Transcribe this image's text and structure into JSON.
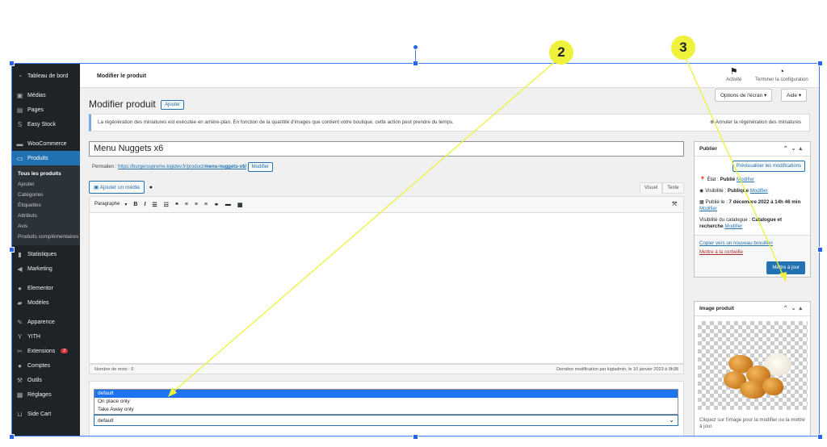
{
  "sidebar": {
    "items": [
      {
        "label": "Tableau de bord",
        "icon": "dashboard-icon"
      },
      {
        "label": "Médias",
        "icon": "media-icon"
      },
      {
        "label": "Pages",
        "icon": "pages-icon"
      },
      {
        "label": "Easy Stock",
        "icon": "stock-icon"
      },
      {
        "label": "WooCommerce",
        "icon": "woocommerce-icon"
      },
      {
        "label": "Produits",
        "icon": "products-icon"
      }
    ],
    "submenu": [
      "Tous les produits",
      "Ajouter",
      "Catégories",
      "Étiquettes",
      "Attributs",
      "Avis",
      "Produits complémentaires"
    ],
    "items2": [
      {
        "label": "Statistiques",
        "icon": "chart-icon"
      },
      {
        "label": "Marketing",
        "icon": "megaphone-icon"
      },
      {
        "label": "Elementor",
        "icon": "elementor-icon"
      },
      {
        "label": "Modèles",
        "icon": "folder-icon"
      },
      {
        "label": "Apparence",
        "icon": "brush-icon"
      },
      {
        "label": "YITH",
        "icon": "yith-icon"
      },
      {
        "label": "Extensions",
        "icon": "plugin-icon",
        "badge": "2"
      },
      {
        "label": "Comptes",
        "icon": "user-icon"
      },
      {
        "label": "Outils",
        "icon": "wrench-icon"
      },
      {
        "label": "Réglages",
        "icon": "settings-icon"
      },
      {
        "label": "Side Cart",
        "icon": "cart-icon"
      }
    ]
  },
  "topbar": {
    "title": "Modifier le produit",
    "activity": "Activité",
    "finish_setup": "Terminer la configuration"
  },
  "screen_options": "Options de l'écran ▾",
  "help": "Aide ▾",
  "page": {
    "heading": "Modifier produit",
    "add_button": "Ajouter"
  },
  "notice": {
    "text": "La régénération des miniatures est exécutée en arrière-plan. En fonction de la quantité d'images que contient votre boutique, cette action peut prendre du temps.",
    "cancel": "Annuler la régénération des miniatures"
  },
  "product": {
    "title": "Menu Nuggets x6",
    "permalink_label": "Permalien :",
    "permalink_base": "https://burgersupreme.kigidev.fr/product/",
    "permalink_slug": "menu-nuggets-x6/",
    "permalink_edit": "Modifier"
  },
  "editor": {
    "add_media": "Ajouter un média",
    "tab_visual": "Visuel",
    "tab_text": "Texte",
    "format": "Paragraphe",
    "word_count": "Nombre de mots : 0",
    "last_modified": "Dernière modification par kigiadmin, le 10 janvier 2023 à 9h38"
  },
  "dropdown": {
    "options": [
      "default",
      "On place only",
      "Take Away only"
    ],
    "selected": "default"
  },
  "publish": {
    "title": "Publier",
    "preview": "Prévisualiser les modifications",
    "status_label": "État :",
    "status_value": "Publié",
    "visibility_label": "Visibilité :",
    "visibility_value": "Publique",
    "published_label": "Publié le :",
    "published_value": "7 décembre 2022 à 14h 46 min",
    "catalog_label": "Visibilité du catalogue :",
    "catalog_value": "Catalogue et recherche",
    "edit": "Modifier",
    "copy_draft": "Copier vers un nouveau brouillon",
    "trash": "Mettre à la corbeille",
    "update": "Mettre à jour"
  },
  "product_image": {
    "title": "Image produit",
    "hint": "Cliquez sur l'image pour la modifier ou la mettre à jour."
  },
  "annotations": [
    {
      "number": "2"
    },
    {
      "number": "3"
    }
  ],
  "colors": {
    "sidebar_bg": "#1d2327",
    "accent": "#2271b1",
    "annotation": "#eef23a",
    "selection": "#1e74f0"
  }
}
